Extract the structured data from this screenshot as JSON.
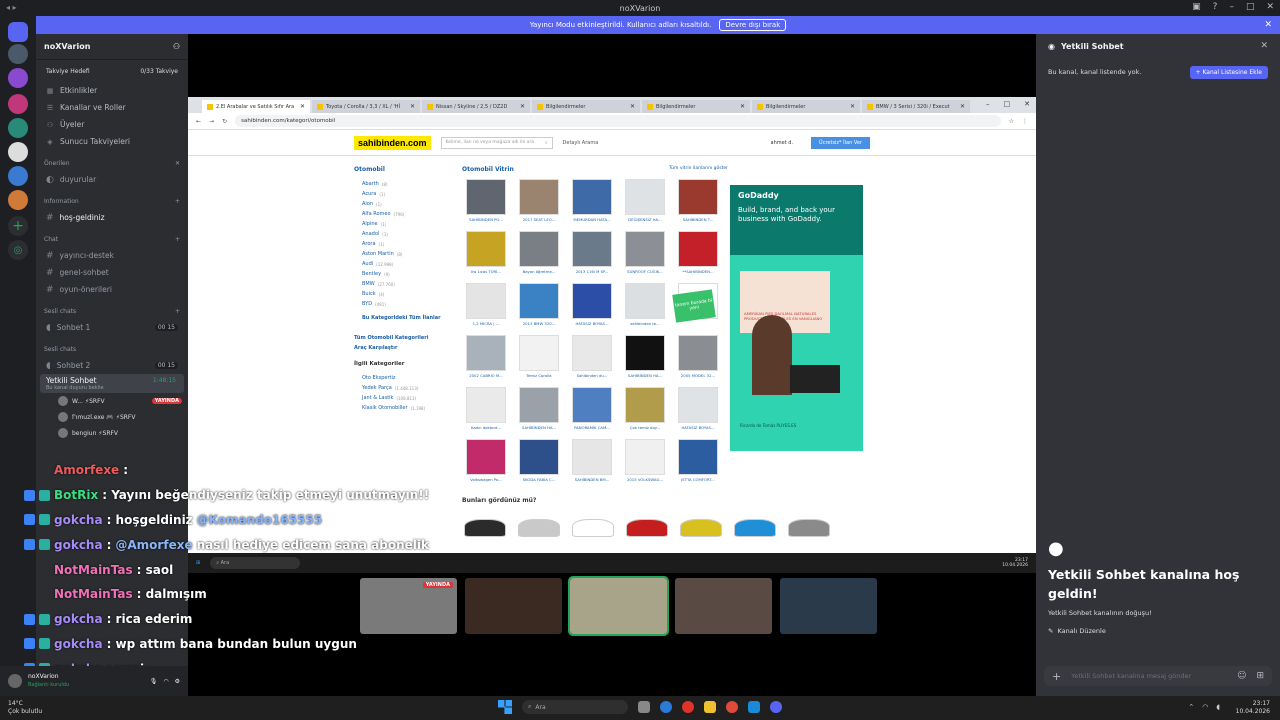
{
  "window": {
    "title": "noXVarion",
    "nav": "◂ ▸"
  },
  "banner": {
    "text": "Yayıncı Modu etkinleştirildi. Kullanıcı adları kısaltıldı.",
    "button": "Devre dışı bırak"
  },
  "server": {
    "name": "noXVarion",
    "boost": {
      "label": "Takviye Hedefi",
      "value": "0/33 Takviye"
    },
    "nav": [
      {
        "label": "Etkinlikler"
      },
      {
        "label": "Kanallar ve Roller"
      },
      {
        "label": "Üyeler"
      },
      {
        "label": "Sunucu Takviyeleri"
      }
    ],
    "cat_onerilen": "Önerilen",
    "ch_duyurular": "duyurular",
    "cat_information": "Information",
    "ch_hosgeldiniz": "hoş-geldiniz",
    "cat_chat": "Chat",
    "ch_chat": [
      "yayıncı-destek",
      "genel-sohbet",
      "oyun-önerileri"
    ],
    "cat_sesli1": "Sesli chats",
    "vc1": {
      "name": "Sohbet 1",
      "count": "00 15"
    },
    "cat_sesli2": "Sesli chats",
    "vc2": {
      "name": "Sohbet 2",
      "count": "00 15"
    },
    "vc_active": {
      "name": "Yetkili Sohbet",
      "sub": "Bu kanal duyuru beklie",
      "time": "1:48:15"
    },
    "voice_users": [
      {
        "name": "W... ⚡SRFV",
        "live": "YAYINDA"
      },
      {
        "name": "ſ'ımuzl.exe 🎮 ⚡SRFV",
        "live": ""
      },
      {
        "name": "bengiun ⚡SRFV",
        "live": ""
      }
    ],
    "user": {
      "name": "noXVarion",
      "status": "Bağlantı kuruldu"
    }
  },
  "browser": {
    "tabs": [
      "2.El Arabalar ve Satılık Sıfır Ara",
      "Toyota / Corolla / 3,3 / XL / 'Hİ",
      "Nissan / Skyline / 2,5 / DZ2D",
      "Bilgilendirmeler",
      "Bilgilendirmeler",
      "Bilgilendirmeler",
      "BMW / 3 Serisi / 320i / Execut"
    ],
    "url": "sahibinden.com/kategori/otomobil",
    "logo": "sahibinden.com",
    "search_placeholder": "Kelime, ilan no veya mağaza adı ile ara",
    "detayli": "Detaylı Arama",
    "user": "ahmet d.",
    "post_btn": "Ücretsiz* İlan Ver",
    "left_title": "Otomobil",
    "brands": [
      {
        "n": "Abarth",
        "c": "(8)"
      },
      {
        "n": "Acura",
        "c": "(1)"
      },
      {
        "n": "Aion",
        "c": "(1)"
      },
      {
        "n": "Alfa Romeo",
        "c": "(796)"
      },
      {
        "n": "Alpine",
        "c": "(1)"
      },
      {
        "n": "Anadol",
        "c": "(3)"
      },
      {
        "n": "Arora",
        "c": "(1)"
      },
      {
        "n": "Aston Martin",
        "c": "(8)"
      },
      {
        "n": "Audi",
        "c": "(12.998)"
      },
      {
        "n": "Bentley",
        "c": "(9)"
      },
      {
        "n": "BMW",
        "c": "(27.760)"
      },
      {
        "n": "Buick",
        "c": "(4)"
      },
      {
        "n": "BYD",
        "c": "(491)"
      }
    ],
    "all_cat_link": "Bu Kategorideki Tüm İlanlar",
    "tum_oto": "Tüm Otomobil Kategorileri",
    "arac_karsilastir": "Araç Karşılaştır",
    "ilgili_title": "İlgili Kategoriler",
    "ilgili": [
      {
        "n": "Oto Ekspertiz",
        "c": ""
      },
      {
        "n": "Yedek Parça",
        "c": "(1.448.113)"
      },
      {
        "n": "Jant & Lastik",
        "c": "(108.813)"
      },
      {
        "n": "Klasik Otomobiller",
        "c": "(1.198)"
      }
    ],
    "vitrin_title": "Otomobil Vitrin",
    "vitrin_all": "Tüm vitrin ilanlarını göster",
    "vitrin_caps": [
      "SAHİBİNDEN PO...",
      "2017 SEAT LEO...",
      "MEMURDAN HATA...",
      "DEĞİŞENSİZ HA...",
      "SAHİBİNDEN T...",
      "Ilw Lıcas TÜRİ...",
      "Bayan öğretme...",
      "2013 116i M SP...",
      "SUNROOF CÜĞİK...",
      "**SAHİBİNDEN...",
      "1,2 MİCRA | ...",
      "2013 BMW 320...",
      "HATASIZ BOYAS...",
      "sahibinden te...",
      "",
      "2002 CABRİO M...",
      "Temiz Corolla",
      "Sahibinden du...",
      "SAHİBİNDEN HA...",
      "2005 MODEL 32...",
      "Kadın doktord...",
      "SAHİBİNDEN HA...",
      "PANORAMİK CAM...",
      "Çok temiz doy...",
      "HATASIZ BOYAS...",
      "Volkswagen Po...",
      "SKODA FABİA C...",
      "SAHİBİNDEN BM...",
      "2015 VOLKSWAG...",
      "JETTA COMFORT..."
    ],
    "vitrin_colors": [
      "#5f6670",
      "#9a8470",
      "#3e6aa8",
      "#dfe2e4",
      "#9a3a2e",
      "#c7a324",
      "#7a7f86",
      "#6a7a8a",
      "#8c9096",
      "#c3202a",
      "#e4e4e4",
      "#3a82c4",
      "#2c4ea6",
      "#dcdfe2",
      "#ffffff",
      "#a9b2bb",
      "#f2f2f2",
      "#e8e8e8",
      "#111111",
      "#8a8d92",
      "#eaeaea",
      "#9aa1a8",
      "#4f7fc0",
      "#b19c4c",
      "#e0e3e6",
      "#c22b6a",
      "#2d4f8a",
      "#e6e6e6",
      "#f0f0f0",
      "#2c5da0"
    ],
    "badge_text": "tanem burada bi yeni",
    "seen_title": "Bunları gördünüz mü?",
    "seen_colors": [
      "#2b2b2b",
      "#c9c9c9",
      "#ffffff",
      "#c41e1e",
      "#d8c020",
      "#1f8fd8",
      "#8a8a8a"
    ],
    "ad": {
      "brand": "GoDaddy",
      "tagline": "Build, brand, and back your business with GoDaddy.",
      "promo": "AMERİKAN PIES DAOLMAL NATURALES PRODUCTOS ASESABLES EN VANIGLIANO",
      "sig": "Ricardo de Tomás PLIYES.ES"
    }
  },
  "inner_taskbar": {
    "search": "Ara",
    "clock": "23:17",
    "date": "10.04.2026"
  },
  "cams": [
    {
      "color": "#7a7a7a",
      "live": "YAYINDA"
    },
    {
      "color": "#3a2a22",
      "live": ""
    },
    {
      "color": "#a8a48a",
      "live": ""
    },
    {
      "color": "#5a4a44",
      "live": ""
    },
    {
      "color": "#2a3a4a",
      "live": ""
    }
  ],
  "chat": [
    {
      "name": "Amorfexe",
      "msg": ":",
      "badge": false,
      "color": "red"
    },
    {
      "name": "BotRix",
      "msg": ": Yayını beğendiyseniz takip etmeyi unutmayın!!",
      "badge": true,
      "color": "green"
    },
    {
      "name": "gokcha",
      "msg": ": hoşgeldiniz",
      "mention": "@Komando165555",
      "badge": true,
      "color": "violet"
    },
    {
      "name": "gokcha",
      "msg": ":",
      "mention": "@Amorfexe",
      "tail": "nasıl hediye edicem sana abonelik",
      "badge": true,
      "color": "violet"
    },
    {
      "name": "NotMainTas",
      "msg": ": saol",
      "badge": false,
      "color": "pink"
    },
    {
      "name": "NotMainTas",
      "msg": ": dalmışım",
      "badge": false,
      "color": "pink"
    },
    {
      "name": "gokcha",
      "msg": ": rica ederim",
      "badge": true,
      "color": "violet"
    },
    {
      "name": "gokcha",
      "msg": ": wp attım bana bundan bulun uygun",
      "badge": true,
      "color": "violet"
    },
    {
      "name": "gokcha",
      "msg": ": yani",
      "badge": true,
      "color": "violet"
    }
  ],
  "right": {
    "title": "Yetkili Sohbet",
    "info": "Bu kanal, kanal listende yok.",
    "add_btn": "Kanal Listesine Ekle",
    "welcome": "Yetkili Sohbet kanalına hoş geldin!",
    "start": "Yetkili Sohbet kanalının doğuşu!",
    "edit": "Kanalı Düzenle",
    "input_placeholder": "Yetkili Sohbet kanalına mesaj gönder"
  },
  "taskbar": {
    "weather_temp": "14°C",
    "weather_desc": "Çok bulutlu",
    "search": "Ara",
    "time": "23:17",
    "date": "10.04.2026"
  }
}
